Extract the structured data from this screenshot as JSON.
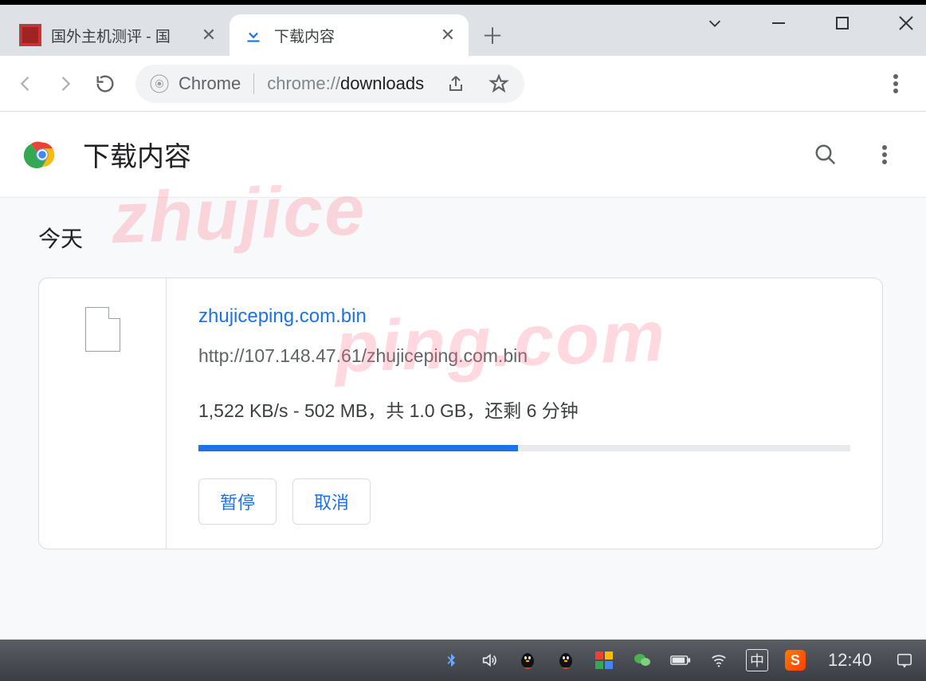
{
  "tabs": [
    {
      "title": "国外主机测评 - 国"
    },
    {
      "title": "下载内容"
    }
  ],
  "omnibox": {
    "label": "Chrome",
    "url_prefix": "chrome://",
    "url_bold": "downloads"
  },
  "page": {
    "title": "下载内容",
    "section": "今天"
  },
  "download": {
    "filename": "zhujiceping.com.bin",
    "url": "http://107.148.47.61/zhujiceping.com.bin",
    "status": "1,522 KB/s - 502 MB，共 1.0 GB，还剩 6 分钟",
    "progress_percent": 49,
    "pause_label": "暂停",
    "cancel_label": "取消"
  },
  "watermark": {
    "part1": "zhujice",
    "part2": "ping.com"
  },
  "taskbar": {
    "ime": "中",
    "sogou": "S",
    "time": "12:40"
  }
}
